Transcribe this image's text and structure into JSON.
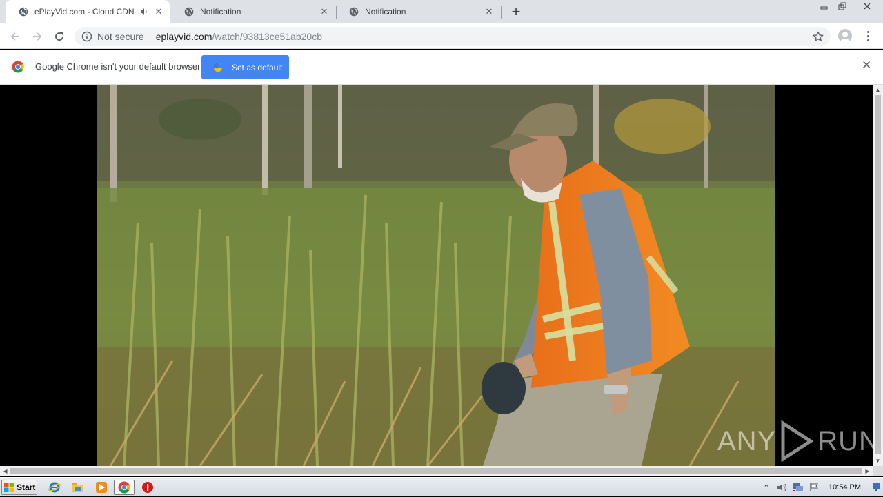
{
  "browser": {
    "tabs": [
      {
        "title": "ePlayVid.com - Cloud CDN",
        "active": true,
        "audio": true
      },
      {
        "title": "Notification",
        "active": false
      },
      {
        "title": "Notification",
        "active": false
      }
    ],
    "new_tab_label": "+",
    "address": {
      "security_text": "Not secure",
      "host": "eplayvid.com",
      "path": "/watch/93813ce51ab20cb"
    }
  },
  "infobar": {
    "message": "Google Chrome isn't your default browser",
    "button_label": "Set as default"
  },
  "content": {
    "video_description": "Video frame of a man in an orange safety vest walking through tall marsh grass",
    "watermark_left": "ANY",
    "watermark_right": "RUN"
  },
  "taskbar": {
    "start_label": "Start",
    "clock": "10:54 PM",
    "pinned_icons": [
      "ie-icon",
      "explorer-icon",
      "media-player-icon",
      "chrome-icon",
      "stop-icon"
    ]
  },
  "colors": {
    "accent_button": "#4285f4",
    "tabstrip": "#dee1e6",
    "page_bg": "#000000"
  }
}
